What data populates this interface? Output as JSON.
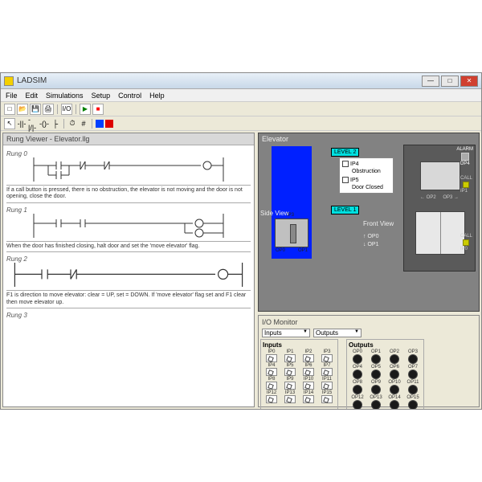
{
  "window": {
    "title": "LADSIM"
  },
  "menu": [
    "File",
    "Edit",
    "Simulations",
    "Setup",
    "Control",
    "Help"
  ],
  "toolbar": {
    "io_label": "I/O"
  },
  "rung_viewer": {
    "title": "Rung Viewer - Elevator.llg",
    "rungs": [
      {
        "label": "Rung 0",
        "text": "If a call button is pressed, there is no obstruction, the elevator is not moving and the door is not opening, close the door."
      },
      {
        "label": "Rung 1",
        "text": "When the door has finished closing, halt door and set the 'move elevator' flag."
      },
      {
        "label": "Rung 2",
        "text": "F1 is direction to move elevator: clear = UP, set = DOWN. If 'move elevator' flag set and F1 clear then move elevator up."
      },
      {
        "label": "Rung 3",
        "text": ""
      }
    ]
  },
  "elevator": {
    "title": "Elevator",
    "levels": [
      "LEVEL 2",
      "LEVEL 1"
    ],
    "side_label": "Side View",
    "front_label": "Front View",
    "checkboxes": [
      {
        "id": "IP4",
        "label": "Obstruction"
      },
      {
        "id": "IP5",
        "label": "Door Closed"
      }
    ],
    "car_io": {
      "top": "IP3",
      "left": "OP0",
      "right": "OP1"
    },
    "arrows": {
      "up": "OP0",
      "down": "OP1"
    },
    "alarm": "ALARM",
    "alarm_op": "OP4",
    "call": "CALL",
    "call_ip_top": "IP1",
    "call_ip_bot": "IP0",
    "door_ops": [
      "OP2",
      "OP3"
    ]
  },
  "io_monitor": {
    "title": "I/O Monitor",
    "select_in": "Inputs",
    "select_out": "Outputs",
    "inputs_label": "Inputs",
    "outputs_label": "Outputs",
    "inputs": [
      "IP0",
      "IP1",
      "IP2",
      "IP3",
      "IP4",
      "IP5",
      "IP6",
      "IP7",
      "IP8",
      "IP9",
      "IP10",
      "IP11",
      "IP12",
      "IP13",
      "IP14",
      "IP15"
    ],
    "outputs": [
      "OP0",
      "OP1",
      "OP2",
      "OP3",
      "OP4",
      "OP5",
      "OP6",
      "OP7",
      "OP8",
      "OP9",
      "OP10",
      "OP11",
      "OP12",
      "OP13",
      "OP14",
      "OP15"
    ]
  }
}
